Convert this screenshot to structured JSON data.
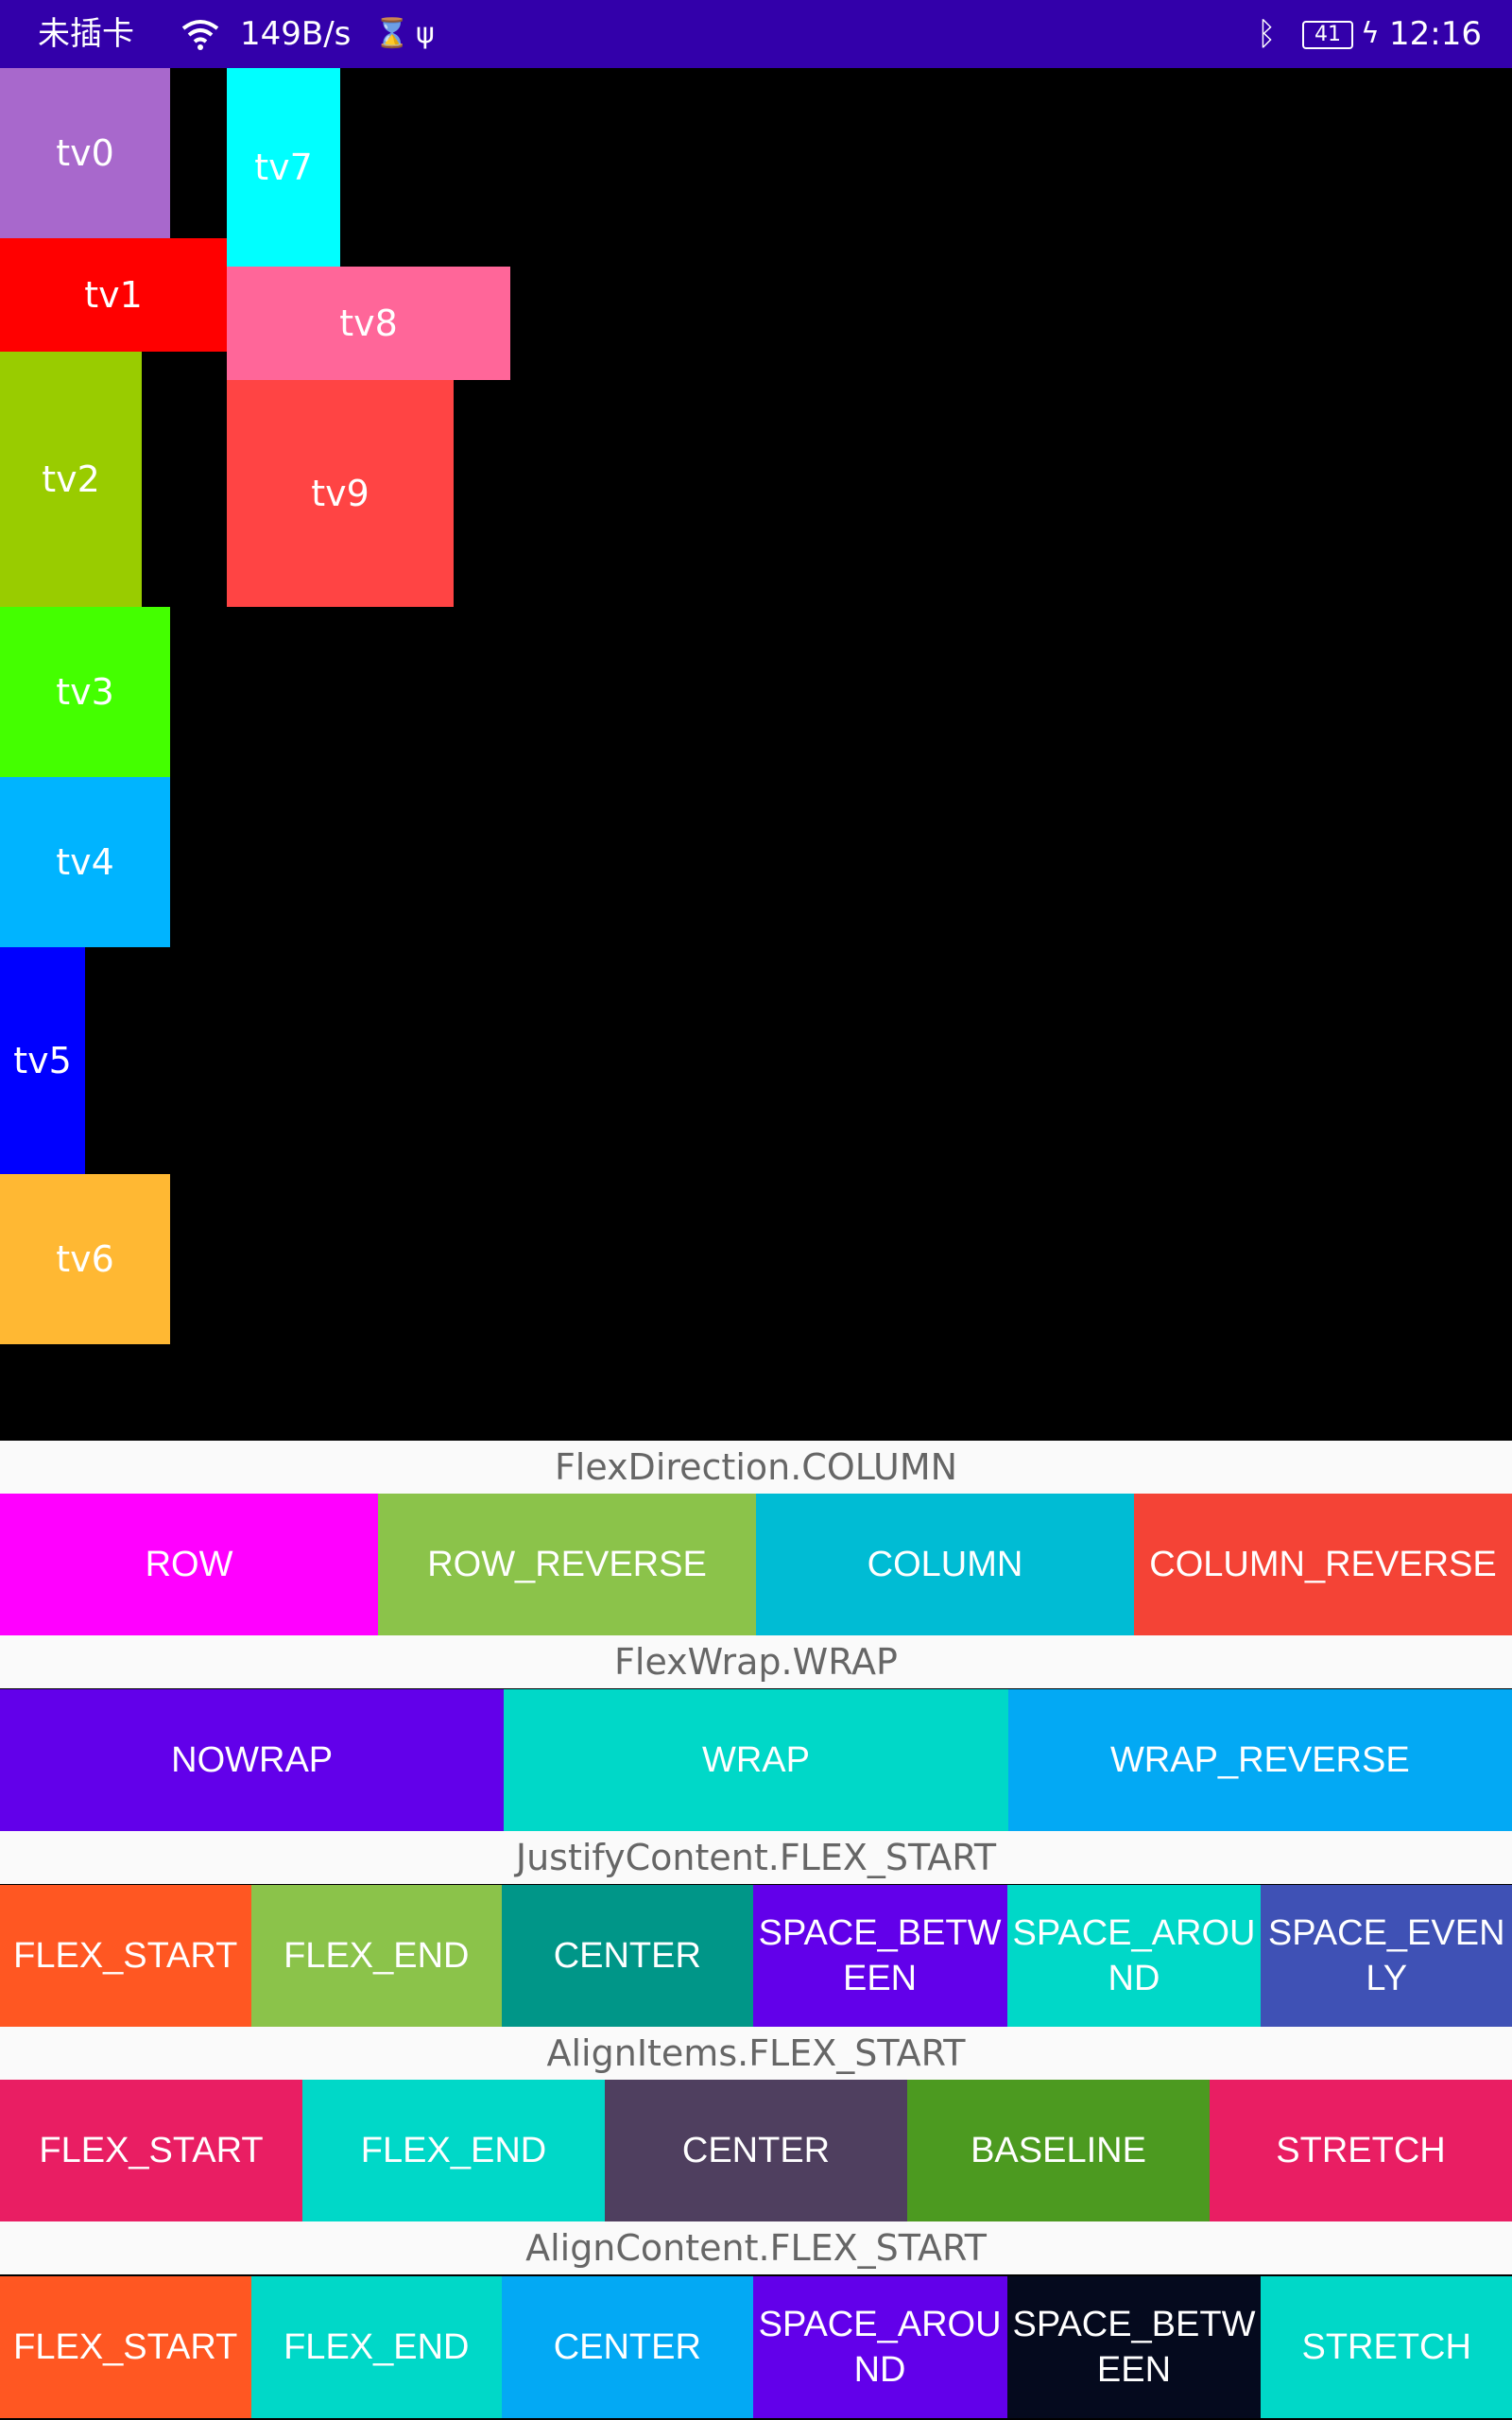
{
  "status_bar": {
    "left_text": "未插卡",
    "net_speed": "149B/s",
    "battery": "41",
    "time": "12:16",
    "icons": [
      "sim-alert-icon",
      "wifi-icon",
      "hourglass-icon",
      "usb-icon",
      "bluetooth-icon",
      "battery-icon",
      "charging-icon"
    ]
  },
  "flex_items": [
    {
      "label": "tv0",
      "color": "#a868cc"
    },
    {
      "label": "tv1",
      "color": "#ff0000"
    },
    {
      "label": "tv2",
      "color": "#99cc00"
    },
    {
      "label": "tv3",
      "color": "#44ff00"
    },
    {
      "label": "tv4",
      "color": "#00b4ff"
    },
    {
      "label": "tv5",
      "color": "#0000ff"
    },
    {
      "label": "tv6",
      "color": "#ffb833"
    },
    {
      "label": "tv7",
      "color": "#00ffff"
    },
    {
      "label": "tv8",
      "color": "#ff6699"
    },
    {
      "label": "tv9",
      "color": "#ff4444"
    }
  ],
  "sections": {
    "flex_direction": {
      "label": "FlexDirection.COLUMN",
      "buttons": [
        {
          "label": "ROW",
          "color": "#ff00ff"
        },
        {
          "label": "ROW_REVERSE",
          "color": "#8bc34a"
        },
        {
          "label": "COLUMN",
          "color": "#00bcd4"
        },
        {
          "label": "COLUMN_REVERSE",
          "color": "#f44336"
        }
      ]
    },
    "flex_wrap": {
      "label": "FlexWrap.WRAP",
      "buttons": [
        {
          "label": "NOWRAP",
          "color": "#6200ea"
        },
        {
          "label": "WRAP",
          "color": "#00d8c8"
        },
        {
          "label": "WRAP_REVERSE",
          "color": "#03a9f4"
        }
      ]
    },
    "justify_content": {
      "label": "JustifyContent.FLEX_START",
      "buttons": [
        {
          "label": "FLEX_START",
          "color": "#ff5722"
        },
        {
          "label": "FLEX_END",
          "color": "#8bc34a"
        },
        {
          "label": "CENTER",
          "color": "#009688"
        },
        {
          "label": "SPACE_BETW",
          "label2": "EEN",
          "color": "#6200ea"
        },
        {
          "label": "SPACE_AROU",
          "label2": "ND",
          "color": "#00d8c8"
        },
        {
          "label": "SPACE_EVEN",
          "label2": "LY",
          "color": "#3f51b5"
        }
      ]
    },
    "align_items": {
      "label": "AlignItems.FLEX_START",
      "buttons": [
        {
          "label": "FLEX_START",
          "color": "#e91e63"
        },
        {
          "label": "FLEX_END",
          "color": "#00d8c8"
        },
        {
          "label": "CENTER",
          "color": "#4f3f5f"
        },
        {
          "label": "BASELINE",
          "color": "#4c9a20"
        },
        {
          "label": "STRETCH",
          "color": "#e91e63"
        }
      ]
    },
    "align_content": {
      "label": "AlignContent.FLEX_START",
      "buttons": [
        {
          "label": "FLEX_START",
          "color": "#ff5722"
        },
        {
          "label": "FLEX_END",
          "color": "#00d8c8"
        },
        {
          "label": "CENTER",
          "color": "#03a9f4"
        },
        {
          "label": "SPACE_AROU",
          "label2": "ND",
          "color": "#6200ea"
        },
        {
          "label": "SPACE_BETW",
          "label2": "EEN",
          "color": "#050a1e"
        },
        {
          "label": "STRETCH",
          "color": "#00d8c8"
        }
      ]
    }
  }
}
